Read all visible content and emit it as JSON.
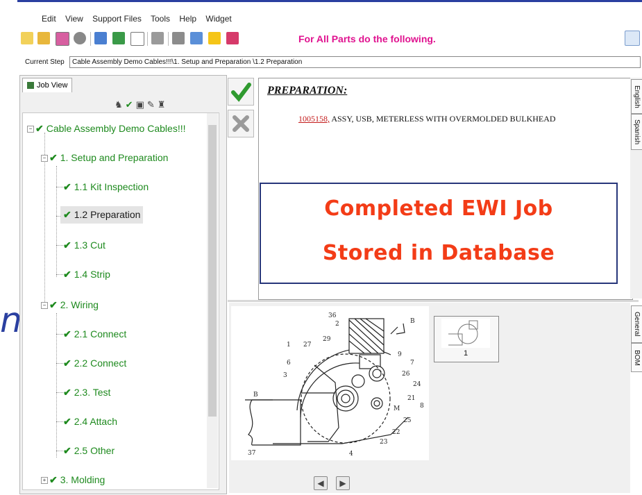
{
  "menu": [
    "Edit",
    "View",
    "Support Files",
    "Tools",
    "Help",
    "Widget"
  ],
  "toolbar": {
    "message": "For All Parts do the following.",
    "message_color": "#e0128f"
  },
  "step": {
    "label": "Current Step",
    "value": "Cable Assembly Demo Cables!!!\\1. Setup and Preparation \\1.2 Preparation"
  },
  "left_tab": "Job View",
  "tree": {
    "root": "Cable Assembly Demo Cables!!!",
    "s1": "1. Setup and Preparation",
    "s1_1": "1.1 Kit Inspection",
    "s1_2": "1.2 Preparation",
    "s1_3": "1.3 Cut",
    "s1_4": "1.4 Strip",
    "s2": "2. Wiring",
    "s2_1": "2.1 Connect",
    "s2_2": "2.2 Connect",
    "s2_3": "2.3. Test",
    "s2_4": "2.4 Attach",
    "s2_5": "2.5 Other",
    "s3": "3. Molding"
  },
  "doc": {
    "heading": "PREPARATION:",
    "part_number": "1005158,",
    "part_desc": " ASSY, USB, METERLESS WITH OVERMOLDED BULKHEAD"
  },
  "overlay": {
    "line1": "Completed EWI Job",
    "line2": "Stored in Database",
    "text_color": "#f33c17",
    "border_color": "#27367a"
  },
  "side_tabs_top": [
    "English",
    "Spanish"
  ],
  "side_tabs_bottom": [
    "General",
    "BOM"
  ],
  "drawing_labels": [
    "36",
    "2",
    "B",
    "1",
    "27",
    "29",
    "9",
    "7",
    "6",
    "26",
    "3",
    "24",
    "21",
    "B",
    "8",
    "M",
    "25",
    "22",
    "23",
    "37",
    "4"
  ],
  "thumbnail_label": "1",
  "tree_color": "#1e8a1e"
}
